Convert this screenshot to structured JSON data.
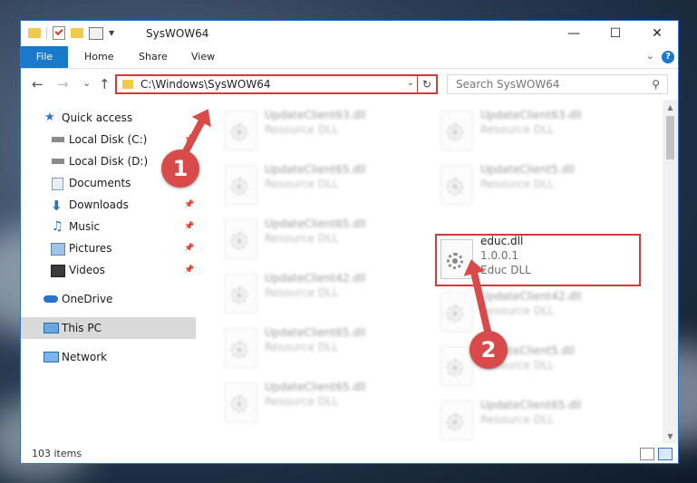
{
  "window": {
    "title": "SysWOW64",
    "controls": {
      "minimize": "—",
      "maximize": "☐",
      "close": "✕"
    }
  },
  "ribbon": {
    "tabs": [
      "File",
      "Home",
      "Share",
      "View"
    ],
    "help": "?"
  },
  "navigation": {
    "back": "←",
    "forward": "→",
    "recent": "⌄",
    "up": "↑",
    "address": "C:\\Windows\\SysWOW64",
    "search_placeholder": "Search SysWOW64"
  },
  "sidebar": {
    "items": [
      {
        "label": "Quick access",
        "icon": "star-icon",
        "pinned": false
      },
      {
        "label": "Local Disk (C:)",
        "icon": "drive-icon",
        "pinned": true
      },
      {
        "label": "Local Disk (D:)",
        "icon": "drive-icon",
        "pinned": true
      },
      {
        "label": "Documents",
        "icon": "documents-icon",
        "pinned": true
      },
      {
        "label": "Downloads",
        "icon": "download-icon",
        "pinned": true
      },
      {
        "label": "Music",
        "icon": "music-icon",
        "pinned": true
      },
      {
        "label": "Pictures",
        "icon": "pictures-icon",
        "pinned": true
      },
      {
        "label": "Videos",
        "icon": "videos-icon",
        "pinned": true
      },
      {
        "label": "OneDrive",
        "icon": "cloud-icon",
        "pinned": false
      },
      {
        "label": "This PC",
        "icon": "computer-icon",
        "pinned": false,
        "selected": true
      },
      {
        "label": "Network",
        "icon": "network-icon",
        "pinned": false
      }
    ]
  },
  "files": {
    "col1": [
      {
        "name": "UpdateClient63.dll",
        "desc": "Resource DLL"
      },
      {
        "name": "UpdateClient65.dll",
        "desc": "Resource DLL"
      },
      {
        "name": "UpdateClient65.dll",
        "desc": "Resource DLL"
      },
      {
        "name": "UpdateClient42.dll",
        "desc": "Resource DLL"
      },
      {
        "name": "UpdateClient65.dll",
        "desc": "Resource DLL"
      },
      {
        "name": "UpdateClient65.dll",
        "desc": "Resource DLL"
      }
    ],
    "col2": [
      {
        "name": "UpdateClient63.dll",
        "desc": "Resource DLL"
      },
      {
        "name": "UpdateClient5.dll",
        "desc": "Resource DLL"
      },
      {
        "name": "educ.dll",
        "desc": "1.0.0.1",
        "desc2": "Educ DLL",
        "highlighted": true
      },
      {
        "name": "UpdateClient42.dll",
        "desc": "Resource DLL"
      },
      {
        "name": "UpdateClient5.dll",
        "desc": "Resource DLL"
      },
      {
        "name": "UpdateClient65.dll",
        "desc": "Resource DLL"
      }
    ]
  },
  "status": {
    "item_count": "103 items"
  },
  "callouts": [
    "1",
    "2"
  ],
  "colors": {
    "accent": "#1979ca",
    "annotation": "#d94b4b"
  }
}
